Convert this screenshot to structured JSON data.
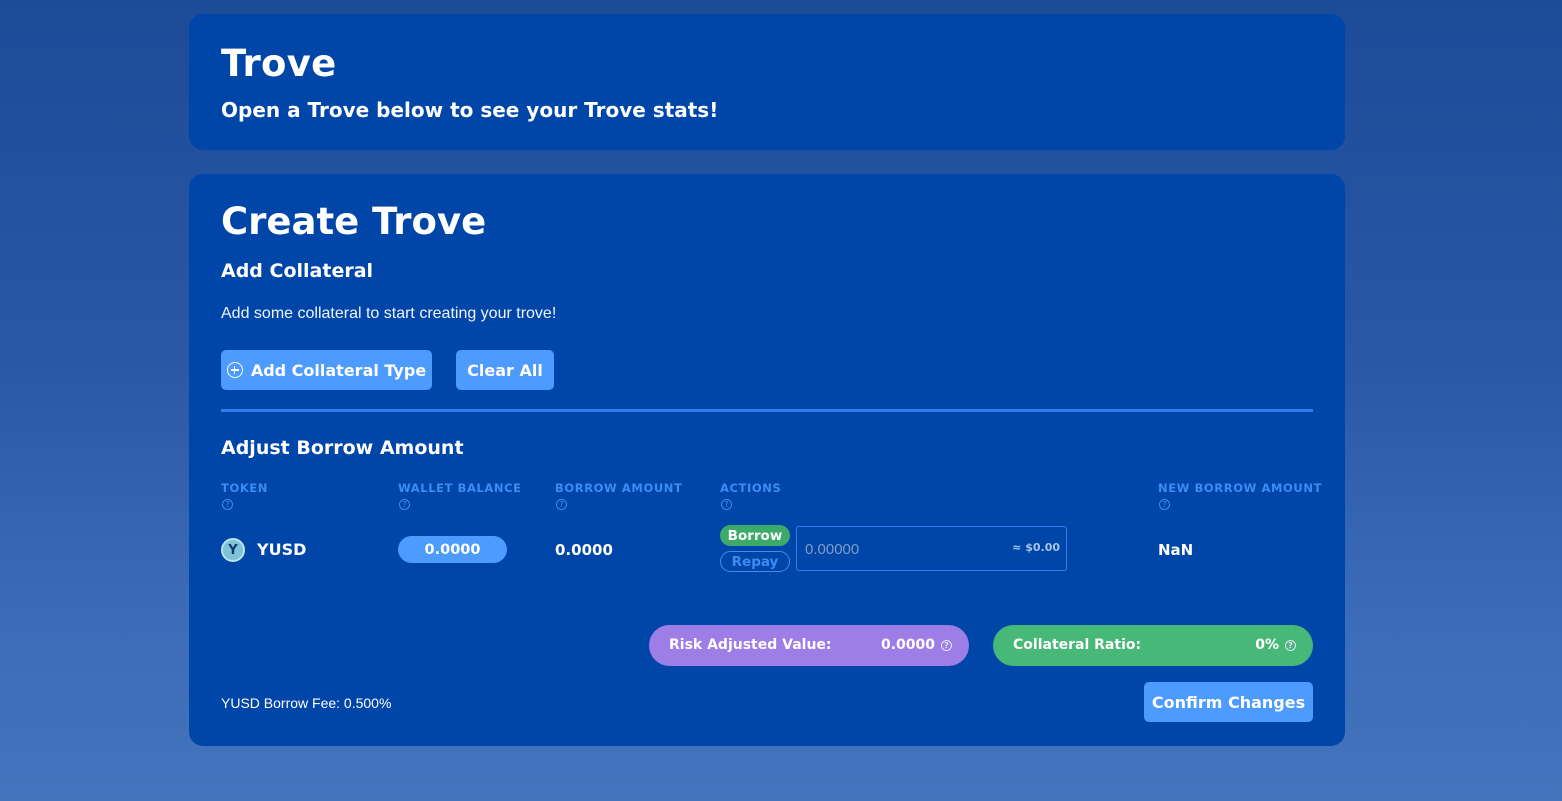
{
  "trove": {
    "title": "Trove",
    "subtitle": "Open a Trove below to see your Trove stats!"
  },
  "create": {
    "title": "Create Trove",
    "add_collateral": {
      "title": "Add Collateral",
      "description": "Add some collateral to start creating your trove!",
      "add_button": "Add Collateral Type",
      "clear_button": "Clear All"
    },
    "adjust": {
      "title": "Adjust Borrow Amount",
      "columns": [
        "TOKEN",
        "WALLET BALANCE",
        "BORROW AMOUNT",
        "ACTIONS",
        "NEW BORROW AMOUNT"
      ],
      "help_glyph": "?",
      "row": {
        "token_icon": "yusd-token-icon",
        "token_glyph": "Y",
        "token": "YUSD",
        "wallet_balance": "0.0000",
        "borrow_amount": "0.0000",
        "borrow_tag": "Borrow",
        "repay_tag": "Repay",
        "input_placeholder": "0.00000",
        "input_value": "",
        "usd_estimate": "≈ $0.00",
        "new_borrow_amount": "NaN"
      }
    },
    "stats": {
      "risk_label": "Risk Adjusted Value:",
      "risk_value": "0.0000",
      "ratio_label": "Collateral Ratio:",
      "ratio_value": "0%"
    },
    "fee_text": "YUSD Borrow Fee: 0.500%",
    "confirm_button": "Confirm Changes"
  },
  "colors": {
    "background": "#2a58a6",
    "card": "#0046a8",
    "button": "#4d9bff",
    "accent_blue": "#3b8cf5",
    "borrow_green": "#3cab6a",
    "risk_purple": "#9d7de6",
    "ratio_green": "#47b877"
  }
}
